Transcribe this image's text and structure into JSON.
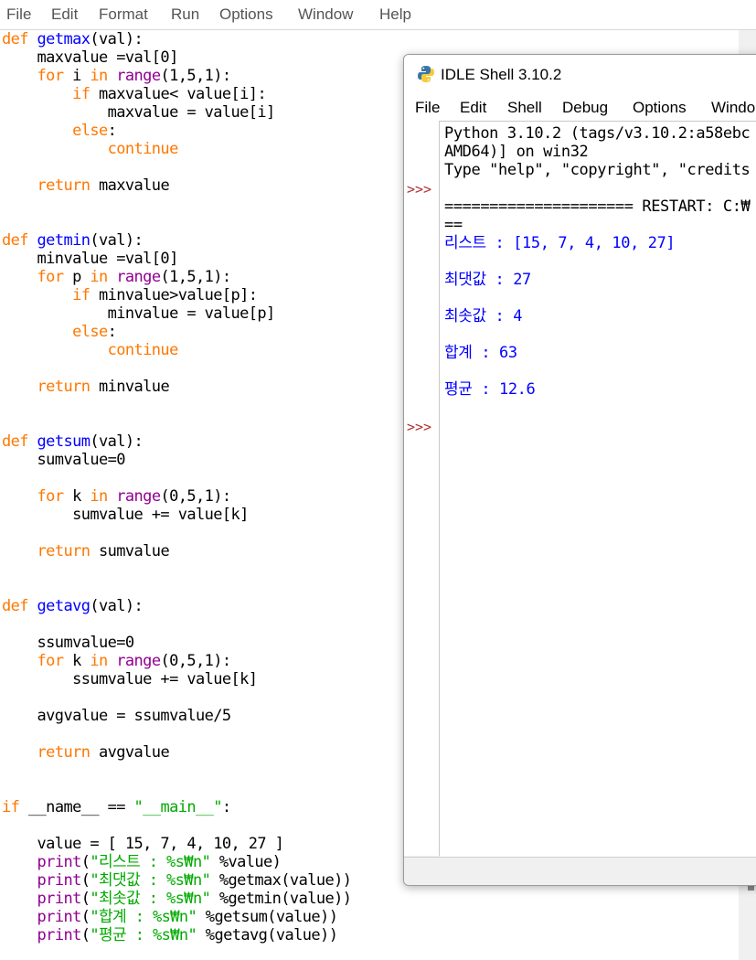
{
  "editor": {
    "menu": [
      "File",
      "Edit",
      "Format",
      "Run",
      "Options",
      "Window",
      "Help"
    ],
    "code": {
      "l1": {
        "a": "def",
        "b": " ",
        "c": "getmax",
        "d": "(val):"
      },
      "l2": "    maxvalue =val[0]",
      "l3": {
        "a": "    ",
        "b": "for",
        "c": " i ",
        "d": "in",
        "e": " ",
        "f": "range",
        "g": "(1,5,1):"
      },
      "l4": {
        "a": "        ",
        "b": "if",
        "c": " maxvalue< value[i]:"
      },
      "l5": "            maxvalue = value[i]",
      "l6": {
        "a": "        ",
        "b": "else",
        "c": ":"
      },
      "l7": {
        "a": "            ",
        "b": "continue"
      },
      "l8": {
        "a": "    ",
        "b": "return",
        "c": " maxvalue"
      },
      "l9": {
        "a": "def",
        "b": " ",
        "c": "getmin",
        "d": "(val):"
      },
      "l10": "    minvalue =val[0]",
      "l11": {
        "a": "    ",
        "b": "for",
        "c": " p ",
        "d": "in",
        "e": " ",
        "f": "range",
        "g": "(1,5,1):"
      },
      "l12": {
        "a": "        ",
        "b": "if",
        "c": " minvalue>value[p]:"
      },
      "l13": "            minvalue = value[p]",
      "l14": {
        "a": "        ",
        "b": "else",
        "c": ":"
      },
      "l15": {
        "a": "            ",
        "b": "continue"
      },
      "l16": {
        "a": "    ",
        "b": "return",
        "c": " minvalue"
      },
      "l17": {
        "a": "def",
        "b": " ",
        "c": "getsum",
        "d": "(val):"
      },
      "l18": "    sumvalue=0",
      "l19": {
        "a": "    ",
        "b": "for",
        "c": " k ",
        "d": "in",
        "e": " ",
        "f": "range",
        "g": "(0,5,1):"
      },
      "l20": "        sumvalue += value[k]",
      "l21": {
        "a": "    ",
        "b": "return",
        "c": " sumvalue"
      },
      "l22": {
        "a": "def",
        "b": " ",
        "c": "getavg",
        "d": "(val):"
      },
      "l23": "    ssumvalue=0",
      "l24": {
        "a": "    ",
        "b": "for",
        "c": " k ",
        "d": "in",
        "e": " ",
        "f": "range",
        "g": "(0,5,1):"
      },
      "l25": "        ssumvalue += value[k]",
      "l26": "    avgvalue = ssumvalue/5",
      "l27": {
        "a": "    ",
        "b": "return",
        "c": " avgvalue"
      },
      "l28": {
        "a": "if",
        "b": " __name__ == ",
        "c": "\"__main__\"",
        "d": ":"
      },
      "l29": "    value = [ 15, 7, 4, 10, 27 ]",
      "l30": {
        "a": "    ",
        "b": "print",
        "c": "(",
        "d": "\"리스트 : %s₩n\"",
        "e": " %value)"
      },
      "l31": {
        "a": "    ",
        "b": "print",
        "c": "(",
        "d": "\"최댓값 : %s₩n\"",
        "e": " %getmax(value))"
      },
      "l32": {
        "a": "    ",
        "b": "print",
        "c": "(",
        "d": "\"최솟값 : %s₩n\"",
        "e": " %getmin(value))"
      },
      "l33": {
        "a": "    ",
        "b": "print",
        "c": "(",
        "d": "\"합계 : %s₩n\"",
        "e": " %getsum(value))"
      },
      "l34": {
        "a": "    ",
        "b": "print",
        "c": "(",
        "d": "\"평균 : %s₩n\"",
        "e": " %getavg(value))"
      }
    }
  },
  "shell": {
    "title": "IDLE Shell 3.10.2",
    "menu": [
      "File",
      "Edit",
      "Shell",
      "Debug",
      "Options",
      "Windo"
    ],
    "prompt": ">>>",
    "banner": [
      "Python 3.10.2 (tags/v3.10.2:a58ebc",
      "AMD64)] on win32",
      "Type \"help\", \"copyright\", \"credits"
    ],
    "restart": "===================== RESTART: C:₩",
    "restart_cont": "==",
    "output": [
      "리스트 : [15, 7, 4, 10, 27]",
      "최댓값 : 27",
      "최솟값 : 4",
      "합계 : 63",
      "평균 : 12.6"
    ]
  },
  "colors": {
    "keyword": "#ff7700",
    "builtin": "#900090",
    "definition": "#0000ff",
    "string": "#00aa00",
    "output": "#0000ff",
    "prompt": "#b03030"
  }
}
